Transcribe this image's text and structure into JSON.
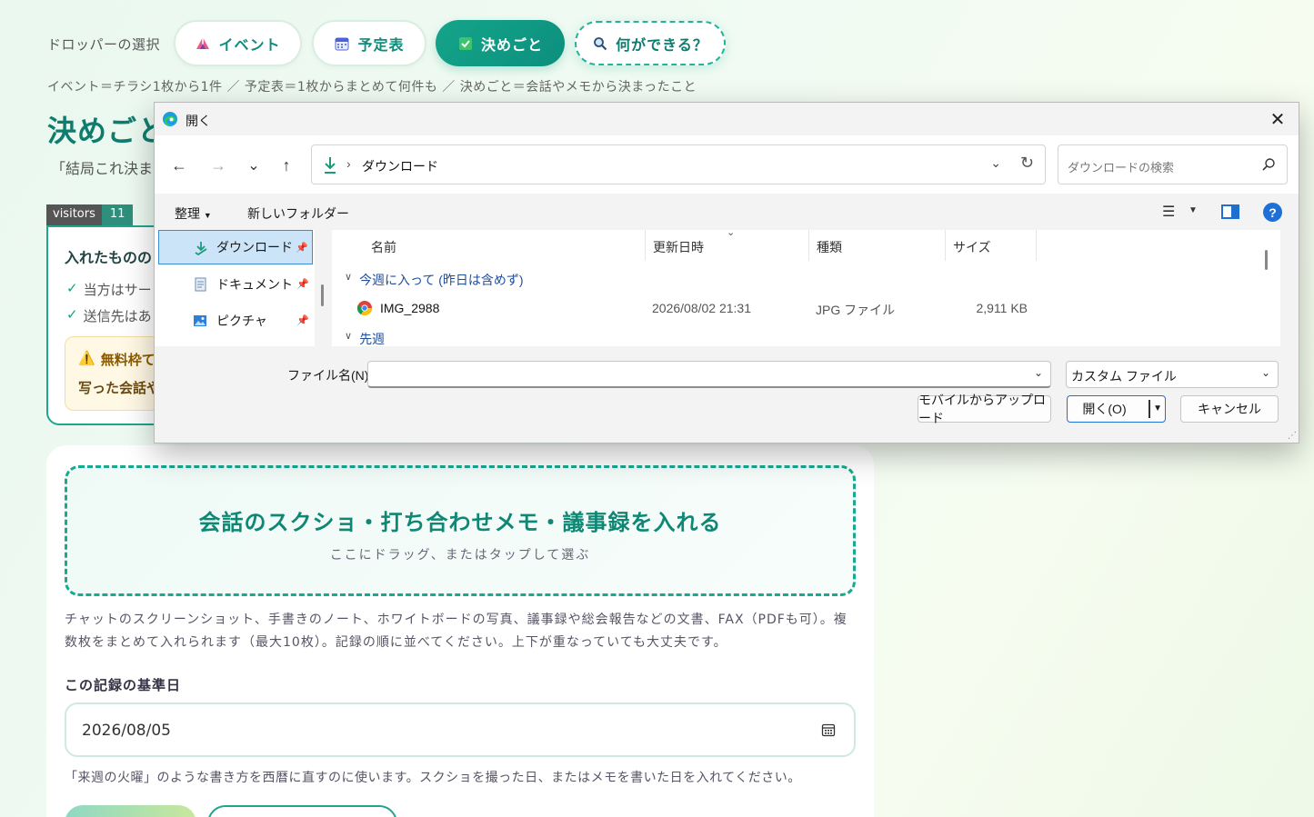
{
  "modes": {
    "label": "ドロッパーの選択",
    "tabs": [
      {
        "label": "イベント",
        "icon": "circus-tent-icon"
      },
      {
        "label": "予定表",
        "icon": "calendar-icon"
      },
      {
        "label": "決めごと",
        "icon": "checkbox-icon",
        "active": true
      },
      {
        "label": "何ができる？",
        "icon": "magnifier-icon"
      }
    ],
    "hint": "イベント＝チラシ1枚から1件 ／ 予定表＝1枚からまとめて何件も ／ 決めごと＝会話やメモから決まったこと"
  },
  "page": {
    "title": "決めごと",
    "subtitle": "「結局これ決ま"
  },
  "visitors": {
    "label": "visitors",
    "count": "11"
  },
  "info_card": {
    "title": "入れたものの",
    "checks": [
      "当方はサー",
      "送信先はあ"
    ],
    "warning_title": "無料枠て",
    "warning_body": "写った会話や"
  },
  "upload": {
    "title": "会話のスクショ・打ち合わせメモ・議事録を入れる",
    "subtitle": "ここにドラッグ、またはタップして選ぶ",
    "description": "チャットのスクリーンショット、手書きのノート、ホワイトボードの写真、議事録や総会報告などの文書、FAX（PDFも可）。複数枚をまとめて入れられます（最大10枚）。記録の順に並べてください。上下が重なっていても大丈夫です。",
    "date_label": "この記録の基準日",
    "date_value": "2026/08/05",
    "date_help": "「来週の火曜」のような書き方を西暦に直すのに使います。スクショを撮った日、またはメモを書いた日を入れてください。"
  },
  "dialog": {
    "title": "開く",
    "close": "✕",
    "nav": {
      "back": "←",
      "forward": "→",
      "recent": "⌄",
      "up": "↑"
    },
    "address": {
      "separator": "›",
      "location": "ダウンロード"
    },
    "search_placeholder": "ダウンロードの検索",
    "toolbar": {
      "organize": "整理",
      "new_folder": "新しいフォルダー",
      "help": "?"
    },
    "sidebar": [
      {
        "label": "ダウンロード",
        "selected": true
      },
      {
        "label": "ドキュメント"
      },
      {
        "label": "ピクチャ"
      }
    ],
    "columns": [
      "名前",
      "更新日時",
      "種類",
      "サイズ"
    ],
    "groups": [
      "今週に入って (昨日は含めず)",
      "先週"
    ],
    "files": [
      {
        "name": "IMG_2988",
        "modified": "2026/08/02 21:31",
        "type": "JPG ファイル",
        "size": "2,911 KB"
      }
    ],
    "filename_label": "ファイル名(N):",
    "filename_value": "",
    "filetype_value": "カスタム ファイル",
    "buttons": {
      "mobile": "モバイルからアップロード",
      "open": "開く(O)",
      "cancel": "キャンセル"
    }
  },
  "colors": {
    "accent": "#14a58a",
    "dialog_accent": "#1e6fd6"
  }
}
